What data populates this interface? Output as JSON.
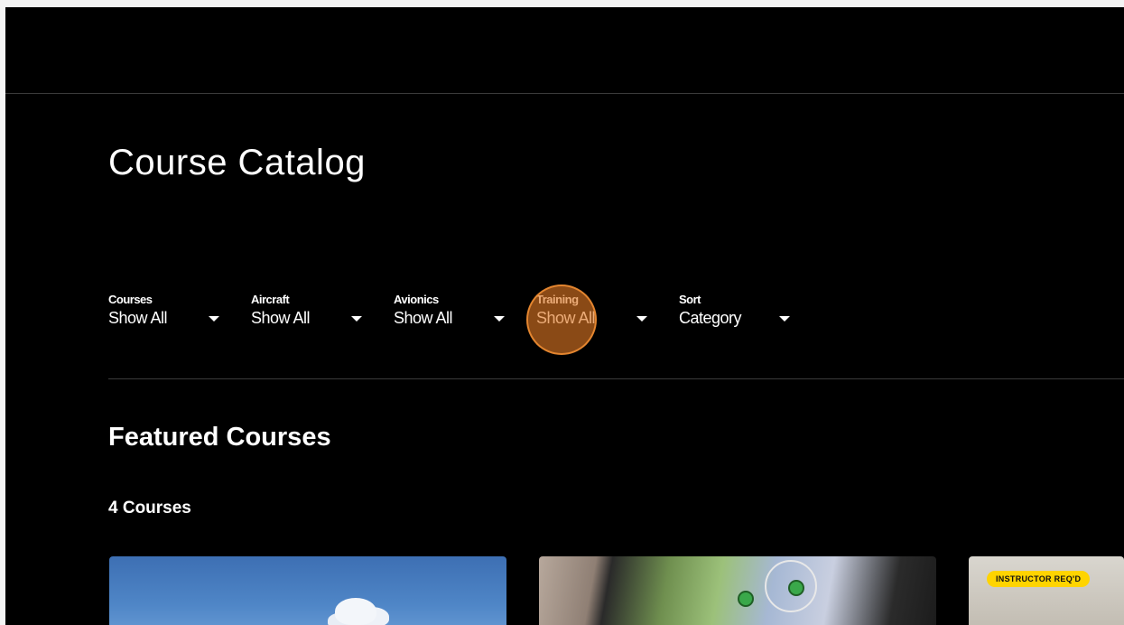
{
  "header": {
    "page_title": "Course Catalog"
  },
  "filters": [
    {
      "label": "Courses",
      "value": "Show All"
    },
    {
      "label": "Aircraft",
      "value": "Show All"
    },
    {
      "label": "Avionics",
      "value": "Show All"
    },
    {
      "label": "Training",
      "value": "Show All"
    },
    {
      "label": "Sort",
      "value": "Category"
    }
  ],
  "featured": {
    "title": "Featured Courses",
    "count_text": "4 Courses",
    "cards": [
      {
        "image": "sky-with-clouds"
      },
      {
        "image": "tablet-weather-radar"
      },
      {
        "image": "cockpit-instructor",
        "badge": "INSTRUCTOR REQ'D"
      }
    ]
  },
  "icons": {
    "dropdown": "caret-down-icon"
  }
}
